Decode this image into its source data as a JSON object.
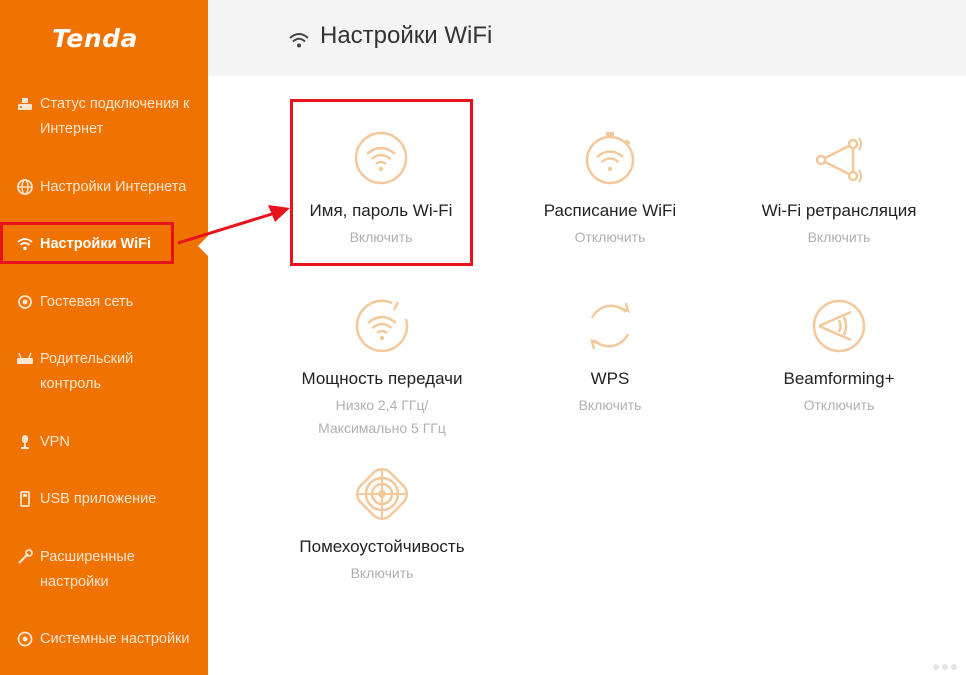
{
  "brand": {
    "logo_text": "Tenda"
  },
  "colors": {
    "sidebar": "#f07200",
    "highlight": "#e8131d",
    "tile_icon": "#f3c89a"
  },
  "sidebar": {
    "items": [
      {
        "label": "Статус подключения к Интернет",
        "icon": "status-icon"
      },
      {
        "label": "Настройки Интернета",
        "icon": "globe-icon"
      },
      {
        "label": "Настройки WiFi",
        "icon": "wifi-icon",
        "active": true
      },
      {
        "label": "Гостевая сеть",
        "icon": "guest-network-icon"
      },
      {
        "label": "Родительский контроль",
        "icon": "parental-control-icon"
      },
      {
        "label": "VPN",
        "icon": "vpn-icon"
      },
      {
        "label": "USB приложение",
        "icon": "usb-icon"
      },
      {
        "label": "Расширенные настройки",
        "icon": "advanced-settings-icon"
      },
      {
        "label": "Системные настройки",
        "icon": "system-settings-icon"
      }
    ]
  },
  "header": {
    "title": "Настройки WiFi",
    "icon": "wifi-icon"
  },
  "tiles": [
    {
      "name": "Имя, пароль Wi-Fi",
      "status": "Включить",
      "icon": "wifi-name-password-icon"
    },
    {
      "name": "Расписание WiFi",
      "status": "Отключить",
      "icon": "wifi-schedule-icon"
    },
    {
      "name": "Wi-Fi ретрансляция",
      "status": "Включить",
      "icon": "wifi-repeater-icon"
    },
    {
      "name": "Мощность передачи",
      "status": "Низко 2,4 ГГц/",
      "status_line2": "Максимально 5 ГГц",
      "icon": "transmit-power-icon"
    },
    {
      "name": "WPS",
      "status": "Включить",
      "icon": "wps-icon"
    },
    {
      "name": "Beamforming+",
      "status": "Отключить",
      "icon": "beamforming-icon"
    },
    {
      "name": "Помехоустойчивость",
      "status": "Включить",
      "icon": "anti-interference-icon"
    }
  ]
}
